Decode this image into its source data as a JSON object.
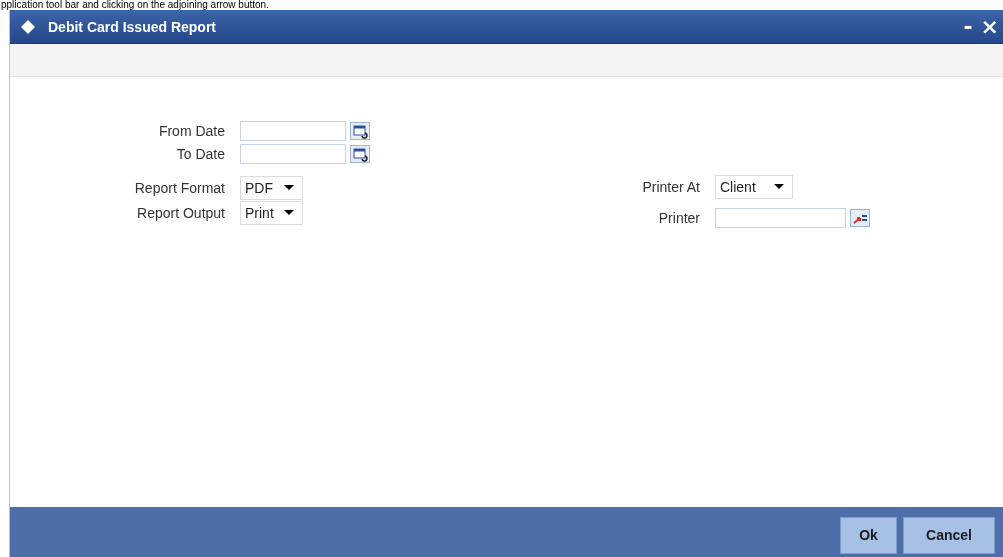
{
  "caption": "pplication tool bar and clicking on the adjoining arrow button.",
  "window": {
    "title": "Debit Card Issued Report",
    "minimize": "-",
    "close": "×"
  },
  "left_fields": [
    {
      "label": "From Date",
      "kind": "date"
    },
    {
      "label": "To Date",
      "kind": "date"
    },
    {
      "label": "Report Format",
      "kind": "select",
      "value": "PDF"
    },
    {
      "label": "Report Output",
      "kind": "select",
      "value": "Print"
    }
  ],
  "right_fields": [
    {
      "label": "Printer At",
      "kind": "select",
      "value": "Client"
    },
    {
      "label": "Printer",
      "kind": "lookup"
    }
  ],
  "buttons": [
    "Ok",
    "Cancel"
  ]
}
